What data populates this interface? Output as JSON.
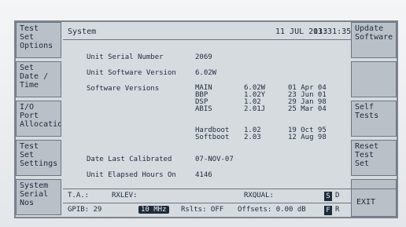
{
  "top_bar": {
    "title": "System",
    "date": "11 JUL 2013",
    "time": "13:31:35"
  },
  "left_softkeys": [
    {
      "label": "Test Set Options"
    },
    {
      "label": "Set Date / Time"
    },
    {
      "label": "I/O Port Allocation"
    },
    {
      "label": "Test Set Settings"
    },
    {
      "label": "System Serial Nos"
    }
  ],
  "right_softkeys": [
    {
      "label": "Update Software"
    },
    {
      "label": ""
    },
    {
      "label": "Self Tests"
    },
    {
      "label": "Reset Test Set"
    },
    {
      "label": ""
    }
  ],
  "main": {
    "unit_serial_number": {
      "label": "Unit Serial Number",
      "value": "2069"
    },
    "unit_software_version": {
      "label": "Unit Software Version",
      "value": "6.02W"
    },
    "software_versions_label": "Software Versions",
    "software_versions": [
      {
        "component": "MAIN",
        "version": "6.02W",
        "date": "01 Apr 04"
      },
      {
        "component": "BBP",
        "version": "1.02Y",
        "date": "23 Jun 01"
      },
      {
        "component": "DSP",
        "version": "1.02",
        "date": "29 Jan 98"
      },
      {
        "component": "ABIS",
        "version": "2.01J",
        "date": "25 Mar 04"
      }
    ],
    "boot_versions": [
      {
        "component": "Hardboot",
        "version": "1.02",
        "date": "19 Oct 95"
      },
      {
        "component": "Softboot",
        "version": "2.03",
        "date": "12 Aug 98"
      }
    ],
    "date_last_calibrated": {
      "label": "Date Last Calibrated",
      "value": "07-NOV-07"
    },
    "unit_elapsed_hours": {
      "label": "Unit Elapsed Hours On",
      "value": "4146"
    }
  },
  "status_bar": {
    "ta_label": "T.A.:",
    "rxlev_label": "RXLEV:",
    "rxqual_label": "RXQUAL:",
    "gpib_label": "GPIB: 29",
    "clock_pill": "10 MHz",
    "rslts_label": "Rslts: OFF",
    "offsets_label": "Offsets: 0.00 dB",
    "s_flag": "S",
    "d_flag": "D",
    "f_flag": "F",
    "r_flag": "R"
  },
  "exit": {
    "label": "EXIT"
  }
}
